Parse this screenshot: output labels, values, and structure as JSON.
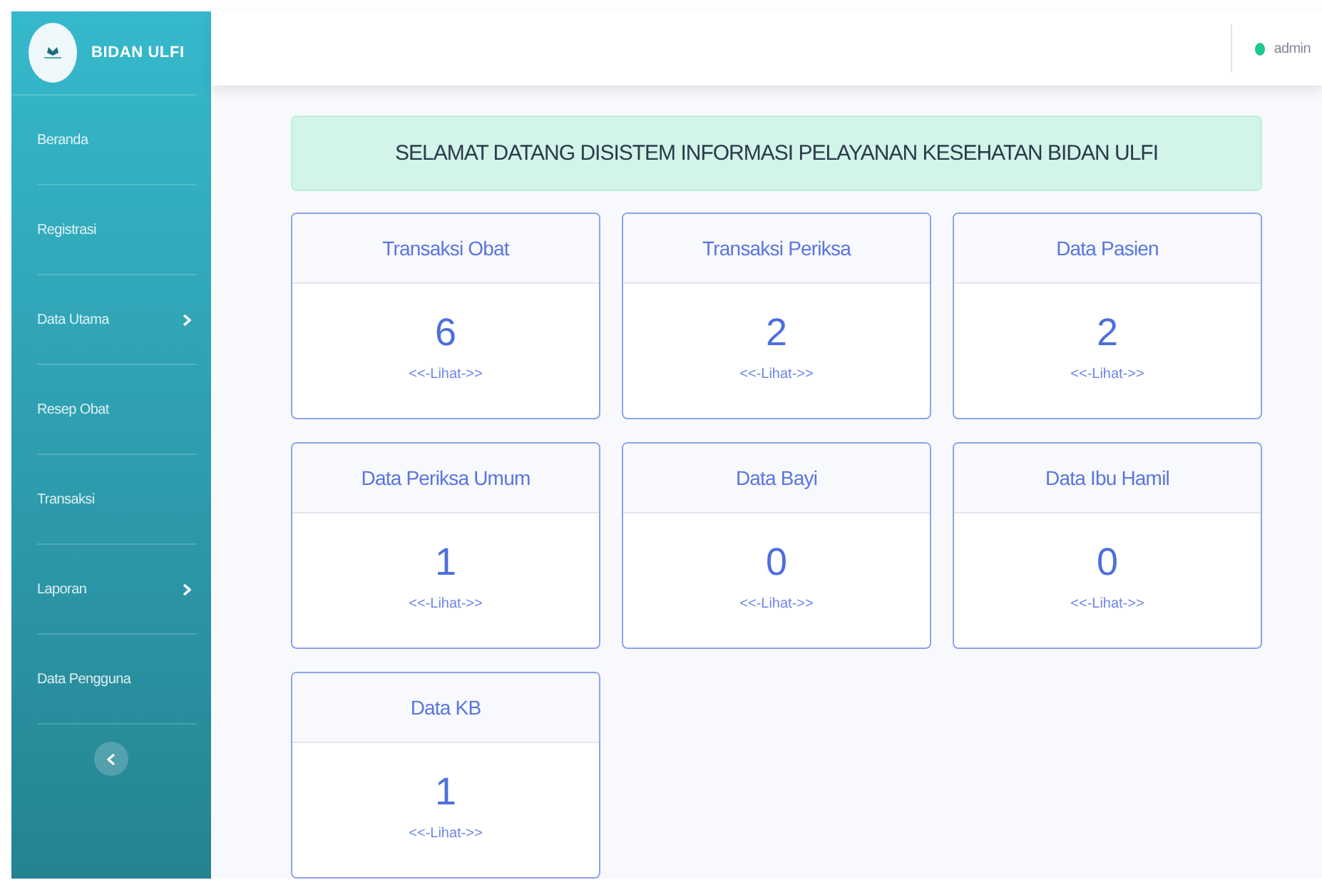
{
  "sidebar": {
    "brand": "BIDAN ULFI",
    "items": [
      {
        "label": "Beranda",
        "kind": "link"
      },
      {
        "label": "Registrasi",
        "kind": "link"
      },
      {
        "label": "Data Utama",
        "kind": "submenu"
      },
      {
        "label": "Resep Obat",
        "kind": "link"
      },
      {
        "label": "Transaksi",
        "kind": "link"
      },
      {
        "label": "Laporan",
        "kind": "submenu"
      },
      {
        "label": "Data Pengguna",
        "kind": "link"
      }
    ]
  },
  "topbar": {
    "user": "admin"
  },
  "welcome": "SELAMAT DATANG DISISTEM INFORMASI PELAYANAN KESEHATAN BIDAN ULFI",
  "cards": [
    {
      "title": "Transaksi Obat",
      "count": "6",
      "link": "<<-Lihat->>"
    },
    {
      "title": "Transaksi Periksa",
      "count": "2",
      "link": "<<-Lihat->>"
    },
    {
      "title": "Data Pasien",
      "count": "2",
      "link": "<<-Lihat->>"
    },
    {
      "title": "Data Periksa Umum",
      "count": "1",
      "link": "<<-Lihat->>"
    },
    {
      "title": "Data Bayi",
      "count": "0",
      "link": "<<-Lihat->>"
    },
    {
      "title": "Data Ibu Hamil",
      "count": "0",
      "link": "<<-Lihat->>"
    },
    {
      "title": "Data KB",
      "count": "1",
      "link": "<<-Lihat->>"
    }
  ]
}
